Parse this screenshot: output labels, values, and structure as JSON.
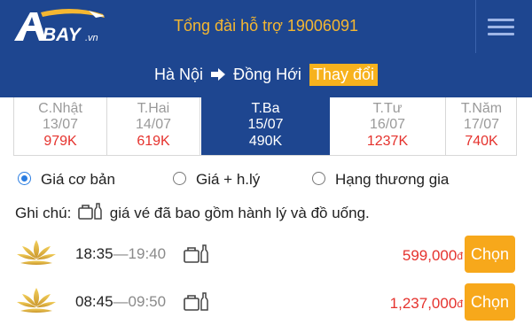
{
  "header": {
    "logo_text": "BAY.vn",
    "hotline": "Tổng đài hỗ trợ 19006091",
    "menu_icon": "hamburger-icon"
  },
  "route": {
    "from": "Hà Nội",
    "to": "Đồng Hới",
    "change_label": "Thay đổi",
    "arrow_icon": "arrow-right-icon"
  },
  "dates": [
    {
      "day": "C.Nhật",
      "date": "13/07",
      "price": "979K",
      "active": false
    },
    {
      "day": "T.Hai",
      "date": "14/07",
      "price": "619K",
      "active": false
    },
    {
      "day": "T.Ba",
      "date": "15/07",
      "price": "490K",
      "active": true
    },
    {
      "day": "T.Tư",
      "date": "16/07",
      "price": "1237K",
      "active": false
    },
    {
      "day": "T.Năm",
      "date": "17/07",
      "price": "740K",
      "active": false
    }
  ],
  "fare_options": {
    "selected": "Giá cơ bản",
    "items": [
      "Giá cơ bản",
      "Giá + h.lý",
      "Hạng thương gia"
    ]
  },
  "note": {
    "prefix": "Ghi chú:",
    "text": "giá vé đã bao gồm hành lý và đồ uống.",
    "icon": "luggage-bottle-icon"
  },
  "flights": [
    {
      "depart": "18:35",
      "arrive": "19:40",
      "price": "599,000",
      "currency": "đ",
      "choose_label": "Chọn",
      "airline_icon": "lotus-logo-icon"
    },
    {
      "depart": "08:45",
      "arrive": "09:50",
      "price": "1,237,000",
      "currency": "đ",
      "choose_label": "Chọn",
      "airline_icon": "lotus-logo-icon"
    }
  ],
  "colors": {
    "brand_blue": "#1e4690",
    "accent_orange": "#f7a81b",
    "hotline_gold": "#f5b731",
    "price_red": "#e5322d",
    "radio_blue": "#2a7de1"
  }
}
